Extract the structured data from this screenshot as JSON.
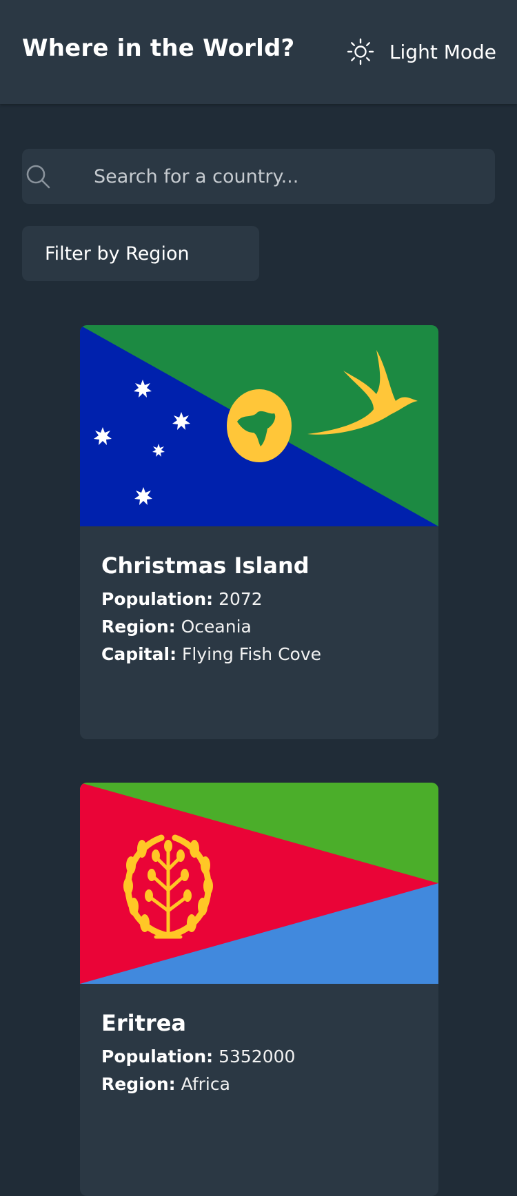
{
  "header": {
    "title": "Where in the World?",
    "mode_toggle_label": "Light Mode",
    "mode_icon": "sun-icon"
  },
  "search": {
    "placeholder": "Search for a country...",
    "value": "",
    "icon": "search-icon"
  },
  "filter": {
    "label": "Filter by Region"
  },
  "countries": [
    {
      "name": "Christmas Island",
      "population_label": "Population:",
      "population": "2072",
      "region_label": "Region:",
      "region": "Oceania",
      "capital_label": "Capital:",
      "capital": "Flying Fish Cove",
      "flag_colors": {
        "blue": "#0021ad",
        "green": "#1c8a42",
        "disc": "#ffc639"
      }
    },
    {
      "name": "Eritrea",
      "population_label": "Population:",
      "population": "5352000",
      "region_label": "Region:",
      "region": "Africa",
      "flag_colors": {
        "green": "#4bae2a",
        "red": "#ea0437",
        "blue": "#4189dd",
        "emblem": "#ffc726"
      }
    }
  ],
  "colors": {
    "background": "#202c37",
    "surface": "#2b3844",
    "text": "#ffffff"
  }
}
